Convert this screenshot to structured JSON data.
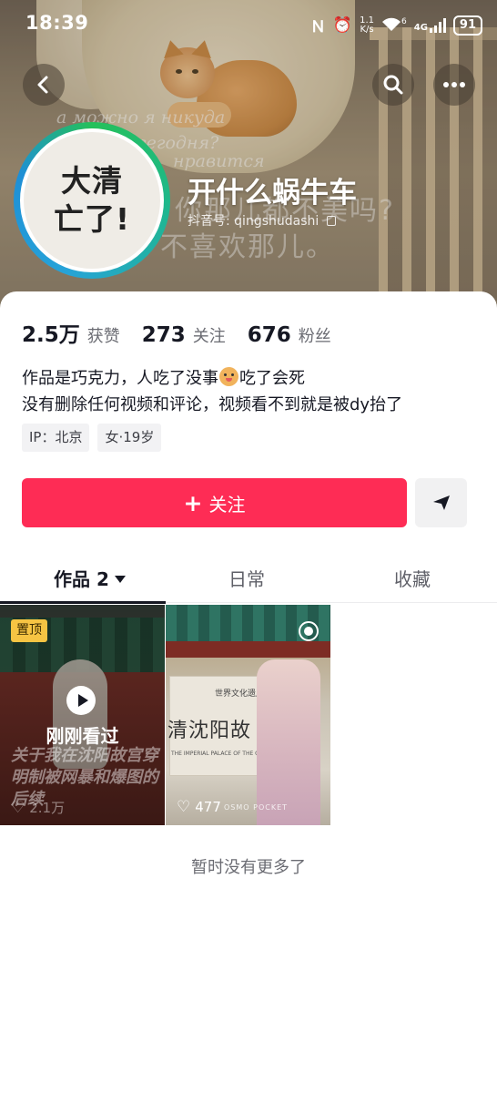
{
  "status_bar": {
    "time": "18:39",
    "network_speed_value": "1.1",
    "network_speed_unit": "K/s",
    "wifi_label": "6",
    "cellular_label": "4G",
    "battery": "91"
  },
  "cover_text": {
    "russian_line1": "а можно я никуда",
    "russian_line2": "сегодня?",
    "russian_line3": "нравится",
    "chinese_line1": "你那儿都不美吗?",
    "chinese_line2": "不喜欢那儿。"
  },
  "profile": {
    "avatar_line1": "大清",
    "avatar_line2": "亡了!",
    "nickname": "开什么蜗牛车",
    "douyin_id": "抖音号: qingshudashi",
    "stats": [
      {
        "value": "2.5万",
        "label": "获赞"
      },
      {
        "value": "273",
        "label": "关注"
      },
      {
        "value": "676",
        "label": "粉丝"
      }
    ],
    "bio_line1_a": "作品是巧克力，人吃了没事",
    "bio_line1_b": "吃了会死",
    "bio_line2": "没有删除任何视频和评论，视频看不到就是被dy抬了",
    "tags": [
      "IP：北京",
      "女·19岁"
    ]
  },
  "actions": {
    "follow_plus": "+",
    "follow_label": "关注"
  },
  "tabs": [
    {
      "label": "作品 2",
      "active": true
    },
    {
      "label": "日常",
      "active": false
    },
    {
      "label": "收藏",
      "active": false
    }
  ],
  "videos": [
    {
      "pinned_label": "置顶",
      "recent_label": "刚刚看过",
      "overlay_title": "关于我在沈阳故宫穿明制被网暴和爆图的后续",
      "likes": "2.1万"
    },
    {
      "plaque_line1": "世界文化遗产",
      "plaque_line2": "清沈阳故",
      "plaque_line3": "THE IMPERIAL PALACE OF THE QING DYNASTY",
      "watermark": "OSMO POCKET",
      "likes": "477"
    }
  ],
  "footer": {
    "no_more": "暂时没有更多了"
  }
}
